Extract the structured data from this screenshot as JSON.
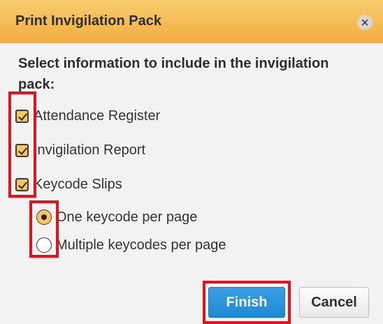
{
  "dialog": {
    "title": "Print Invigilation Pack",
    "close_label": "×",
    "instruction": "Select information to include in the invigilation pack:"
  },
  "options": {
    "checkboxes": [
      {
        "label": "Attendance Register",
        "checked": true
      },
      {
        "label": "Invigilation Report",
        "checked": true
      },
      {
        "label": "Keycode Slips",
        "checked": true
      }
    ],
    "keycode_layout": [
      {
        "label": "One keycode per page",
        "selected": true
      },
      {
        "label": "Multiple keycodes per page",
        "selected": false
      }
    ]
  },
  "buttons": {
    "finish": "Finish",
    "cancel": "Cancel"
  },
  "colors": {
    "titlebar": "#f0ad3c",
    "accent": "#f6c660",
    "primary_button": "#1e88d4",
    "highlight": "#e0141b"
  }
}
